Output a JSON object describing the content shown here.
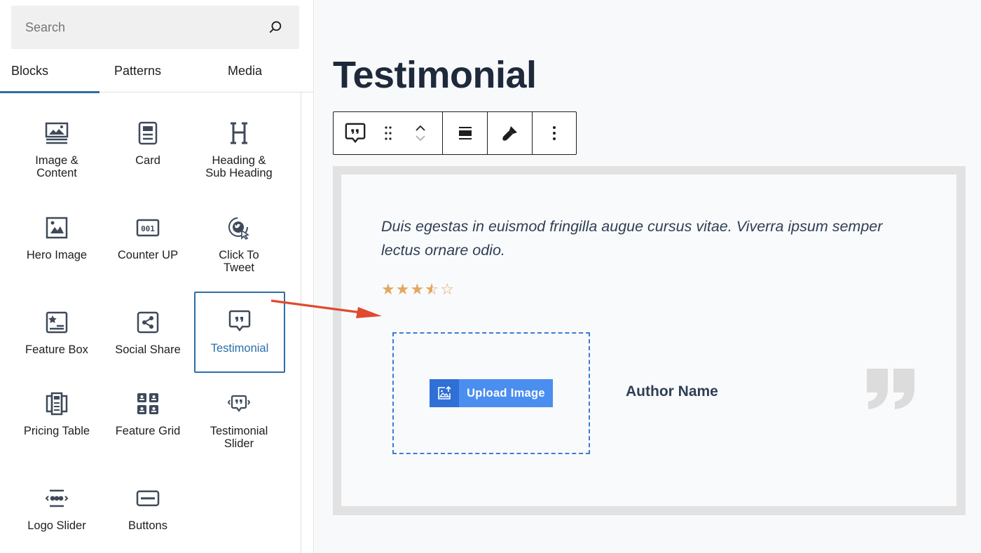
{
  "search": {
    "placeholder": "Search"
  },
  "tabs": [
    {
      "label": "Blocks",
      "active": true
    },
    {
      "label": "Patterns",
      "active": false
    },
    {
      "label": "Media",
      "active": false
    }
  ],
  "blocks": [
    {
      "label": "Image &\nContent",
      "icon": "image-content-icon"
    },
    {
      "label": "Card",
      "icon": "card-icon"
    },
    {
      "label": "Heading &\nSub Heading",
      "icon": "heading-icon"
    },
    {
      "label": "Hero Image",
      "icon": "hero-image-icon"
    },
    {
      "label": "Counter UP",
      "icon": "counter-icon"
    },
    {
      "label": "Click To\nTweet",
      "icon": "tweet-icon"
    },
    {
      "label": "Feature Box",
      "icon": "feature-box-icon"
    },
    {
      "label": "Social Share",
      "icon": "share-icon"
    },
    {
      "label": "Testimonial",
      "icon": "testimonial-icon",
      "selected": true
    },
    {
      "label": "Pricing Table",
      "icon": "pricing-table-icon"
    },
    {
      "label": "Feature Grid",
      "icon": "feature-grid-icon"
    },
    {
      "label": "Testimonial\nSlider",
      "icon": "testimonial-slider-icon"
    },
    {
      "label": "Logo Slider",
      "icon": "logo-slider-icon"
    },
    {
      "label": "Buttons",
      "icon": "buttons-icon"
    }
  ],
  "editor": {
    "title": "Testimonial",
    "quote": "Duis egestas in euismod fringilla augue cursus vitae. Viverra ipsum semper lectus ornare odio.",
    "rating": {
      "value": 3.5,
      "max": 5
    },
    "upload_label": "Upload Image",
    "author": "Author Name"
  },
  "colors": {
    "accent": "#2a6ea8",
    "star": "#e0a860",
    "upload_button": "#4a8ef0",
    "arrow": "#e04a2f"
  }
}
